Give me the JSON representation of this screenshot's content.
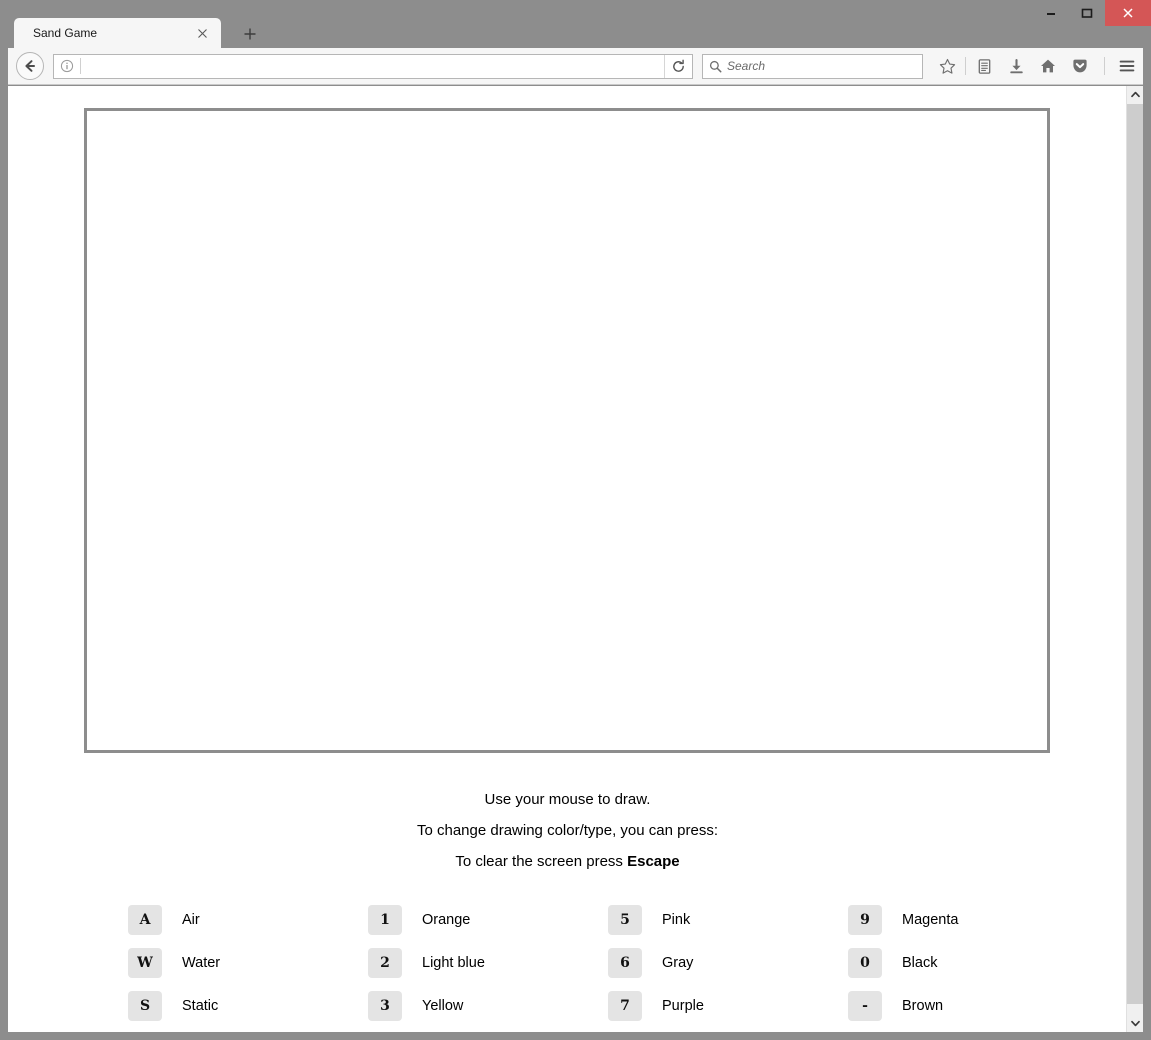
{
  "window": {
    "controls": {
      "minimize": "minimize-button",
      "maximize": "maximize-button",
      "close": "close-button",
      "close_color": "#d45656"
    }
  },
  "browser": {
    "tab": {
      "title": "Sand Game",
      "close_label": "×"
    },
    "new_tab_label": "+",
    "toolbar": {
      "back_label": "Back",
      "identity_icon": "info-icon",
      "url_value": "",
      "url_placeholder": "",
      "reload_label": "Reload",
      "search_placeholder": "Search",
      "icons": [
        {
          "name": "bookmark-star-icon",
          "label": "Bookmark this page"
        },
        {
          "name": "library-icon",
          "label": "Show your bookmarks"
        },
        {
          "name": "download-icon",
          "label": "Downloads"
        },
        {
          "name": "home-icon",
          "label": "Home"
        },
        {
          "name": "pocket-icon",
          "label": "Save to Pocket"
        },
        {
          "name": "menu-hamburger-icon",
          "label": "Open menu"
        }
      ]
    },
    "scrollbar": {
      "up_arrow": "▴",
      "down_arrow": "▾"
    }
  },
  "page": {
    "canvas": {
      "name": "sand-game-canvas",
      "border_color": "#8d8d8d",
      "background": "#ffffff"
    },
    "instructions": [
      {
        "text": "Use your mouse to draw.",
        "bold_suffix": ""
      },
      {
        "text": "To change drawing color/type, you can press:",
        "bold_suffix": ""
      },
      {
        "text": "To clear the screen press ",
        "bold_suffix": "Escape"
      }
    ],
    "keys": [
      {
        "key": "A",
        "label": "Air"
      },
      {
        "key": "1",
        "label": "Orange"
      },
      {
        "key": "5",
        "label": "Pink"
      },
      {
        "key": "9",
        "label": "Magenta"
      },
      {
        "key": "W",
        "label": "Water"
      },
      {
        "key": "2",
        "label": "Light blue"
      },
      {
        "key": "6",
        "label": "Gray"
      },
      {
        "key": "0",
        "label": "Black"
      },
      {
        "key": "S",
        "label": "Static"
      },
      {
        "key": "3",
        "label": "Yellow"
      },
      {
        "key": "7",
        "label": "Purple"
      },
      {
        "key": "-",
        "label": "Brown"
      }
    ]
  }
}
